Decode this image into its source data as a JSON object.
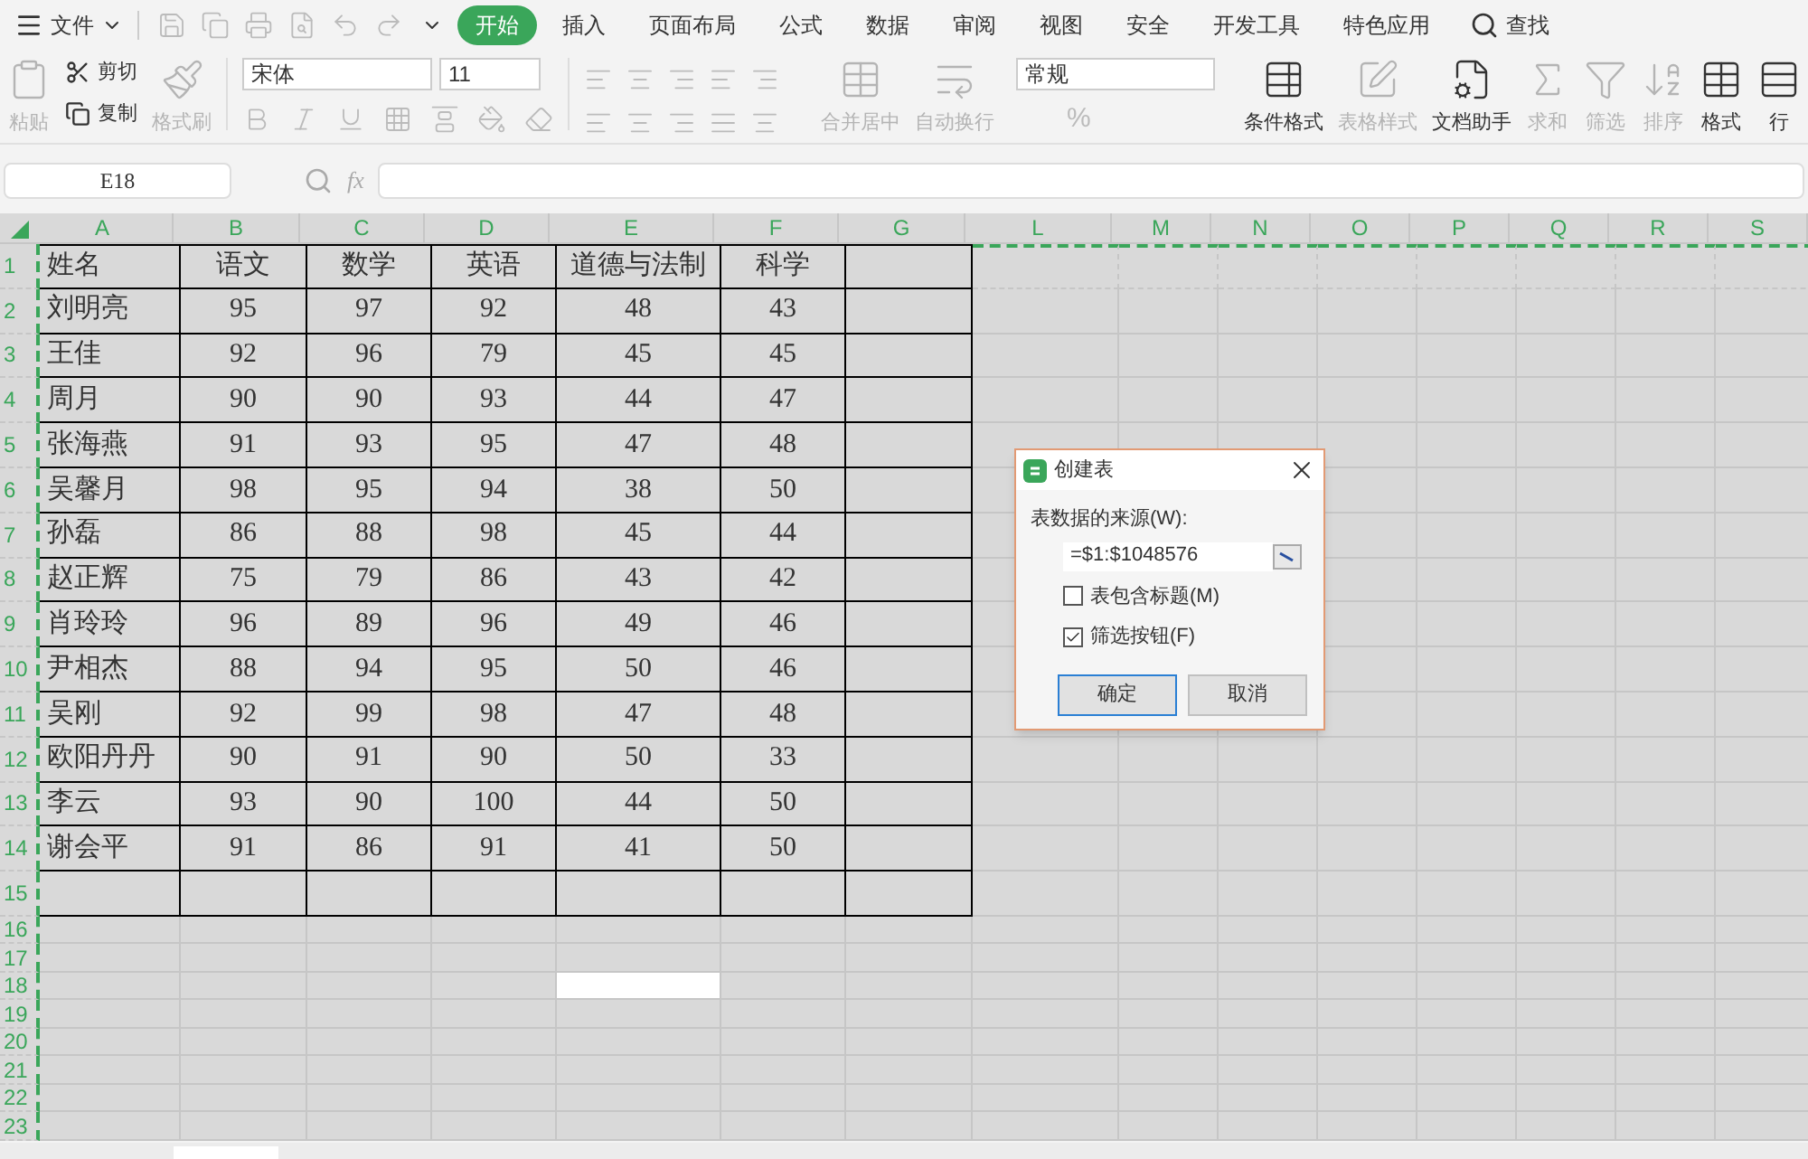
{
  "menu": {
    "file": "文件",
    "tabs": [
      {
        "label": "开始",
        "selected": true
      },
      {
        "label": "插入",
        "selected": false
      },
      {
        "label": "页面布局",
        "selected": false
      },
      {
        "label": "公式",
        "selected": false
      },
      {
        "label": "数据",
        "selected": false
      },
      {
        "label": "审阅",
        "selected": false
      },
      {
        "label": "视图",
        "selected": false
      },
      {
        "label": "安全",
        "selected": false
      },
      {
        "label": "开发工具",
        "selected": false
      },
      {
        "label": "特色应用",
        "selected": false
      }
    ],
    "search": "查找"
  },
  "ribbon": {
    "paste": {
      "label": "粘贴",
      "disabled": true
    },
    "cut": {
      "label": "剪切",
      "disabled": false
    },
    "copy": {
      "label": "复制",
      "disabled": false
    },
    "format_painter": {
      "label": "格式刷",
      "disabled": true
    },
    "font_name": "宋体",
    "font_size": "11",
    "merge": {
      "label": "合并居中",
      "disabled": true
    },
    "wrap": {
      "label": "自动换行",
      "disabled": true
    },
    "number_format": "常规",
    "percent": "%",
    "tools": [
      {
        "kind": "conditional",
        "label": "条件格式",
        "disabled": false
      },
      {
        "kind": "table-style",
        "label": "表格样式",
        "disabled": true
      },
      {
        "kind": "assistant",
        "label": "文档助手",
        "disabled": false
      },
      {
        "kind": "sum",
        "label": "求和",
        "disabled": true
      },
      {
        "kind": "filter",
        "label": "筛选",
        "disabled": true
      },
      {
        "kind": "sort",
        "label": "排序",
        "disabled": true
      },
      {
        "kind": "format",
        "label": "格式",
        "disabled": false
      },
      {
        "kind": "rows",
        "label": "行",
        "disabled": false
      }
    ]
  },
  "name_box": "E18",
  "formula_label": "fx",
  "sheet": {
    "columns": [
      "A",
      "B",
      "C",
      "D",
      "E",
      "F",
      "G",
      "L",
      "M",
      "N",
      "O",
      "P",
      "Q",
      "R",
      "S"
    ],
    "rows": [
      {
        "number": "1",
        "cells": [
          "姓名",
          "语文",
          "数学",
          "英语",
          "道德与法制",
          "科学"
        ]
      },
      {
        "number": "2",
        "cells": [
          "刘明亮",
          "95",
          "97",
          "92",
          "48",
          "43"
        ]
      },
      {
        "number": "3",
        "cells": [
          "王佳",
          "92",
          "96",
          "79",
          "45",
          "45"
        ]
      },
      {
        "number": "4",
        "cells": [
          "周月",
          "90",
          "90",
          "93",
          "44",
          "47"
        ]
      },
      {
        "number": "5",
        "cells": [
          "张海燕",
          "91",
          "93",
          "95",
          "47",
          "48"
        ]
      },
      {
        "number": "6",
        "cells": [
          "吴馨月",
          "98",
          "95",
          "94",
          "38",
          "50"
        ]
      },
      {
        "number": "7",
        "cells": [
          "孙磊",
          "86",
          "88",
          "98",
          "45",
          "44"
        ]
      },
      {
        "number": "8",
        "cells": [
          "赵正辉",
          "75",
          "79",
          "86",
          "43",
          "42"
        ]
      },
      {
        "number": "9",
        "cells": [
          "肖玲玲",
          "96",
          "89",
          "96",
          "49",
          "46"
        ]
      },
      {
        "number": "10",
        "cells": [
          "尹相杰",
          "88",
          "94",
          "95",
          "50",
          "46"
        ]
      },
      {
        "number": "11",
        "cells": [
          "吴刚",
          "92",
          "99",
          "98",
          "47",
          "48"
        ]
      },
      {
        "number": "12",
        "cells": [
          "欧阳丹丹",
          "90",
          "91",
          "90",
          "50",
          "33"
        ]
      },
      {
        "number": "13",
        "cells": [
          "李云",
          "93",
          "90",
          "100",
          "44",
          "50"
        ]
      },
      {
        "number": "14",
        "cells": [
          "谢会平",
          "91",
          "86",
          "91",
          "41",
          "50"
        ]
      },
      {
        "number": "15"
      },
      {
        "number": "16"
      },
      {
        "number": "17"
      },
      {
        "number": "18",
        "active_cell": true
      },
      {
        "number": "19"
      },
      {
        "number": "20"
      },
      {
        "number": "21"
      },
      {
        "number": "22"
      },
      {
        "number": "23"
      }
    ]
  },
  "dialog": {
    "title": "创建表",
    "source_label": "表数据的来源(W):",
    "source_value": "=$1:$1048576",
    "options": [
      {
        "label": "表包含标题(M)",
        "checked": false
      },
      {
        "label": "筛选按钮(F)",
        "checked": true
      }
    ],
    "buttons": [
      {
        "label": "确定",
        "selected": true
      },
      {
        "label": "取消",
        "selected": false
      }
    ]
  }
}
